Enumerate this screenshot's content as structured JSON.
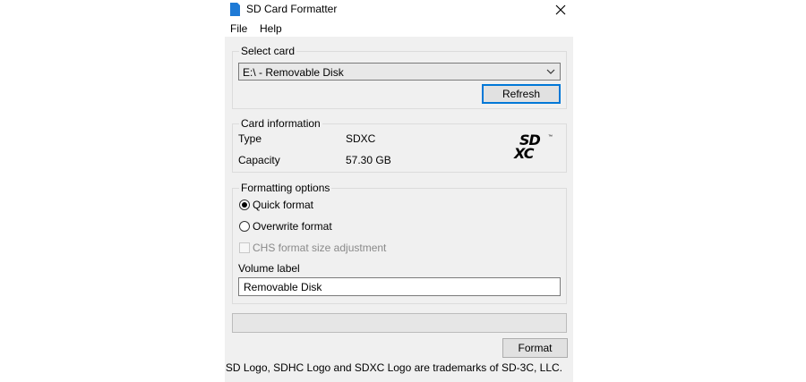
{
  "window": {
    "title": "SD Card Formatter",
    "icon": "sd-card-icon",
    "close_icon": "close-icon"
  },
  "menu": [
    "File",
    "Help"
  ],
  "select_card": {
    "legend": "Select card",
    "selected": "E:\\ - Removable Disk",
    "refresh_label": "Refresh"
  },
  "card_info": {
    "legend": "Card information",
    "type_label": "Type",
    "type_value": "SDXC",
    "capacity_label": "Capacity",
    "capacity_value": "57.30 GB",
    "logo_top": "SD",
    "logo_bottom": "XC"
  },
  "formatting": {
    "legend": "Formatting options",
    "quick_label": "Quick format",
    "quick_selected": true,
    "overwrite_label": "Overwrite format",
    "overwrite_selected": false,
    "chs_label": "CHS format size adjustment",
    "chs_enabled": false,
    "volume_label_title": "Volume label",
    "volume_label_value": "Removable Disk"
  },
  "progress": {
    "value": 0
  },
  "format_label": "Format",
  "footer_text": "SD Logo, SDHC Logo and SDXC Logo are trademarks of SD-3C, LLC.",
  "colors": {
    "focus": "#0078d7",
    "window_bg": "#f0f0f0",
    "icon_blue": "#1e7ad6"
  }
}
